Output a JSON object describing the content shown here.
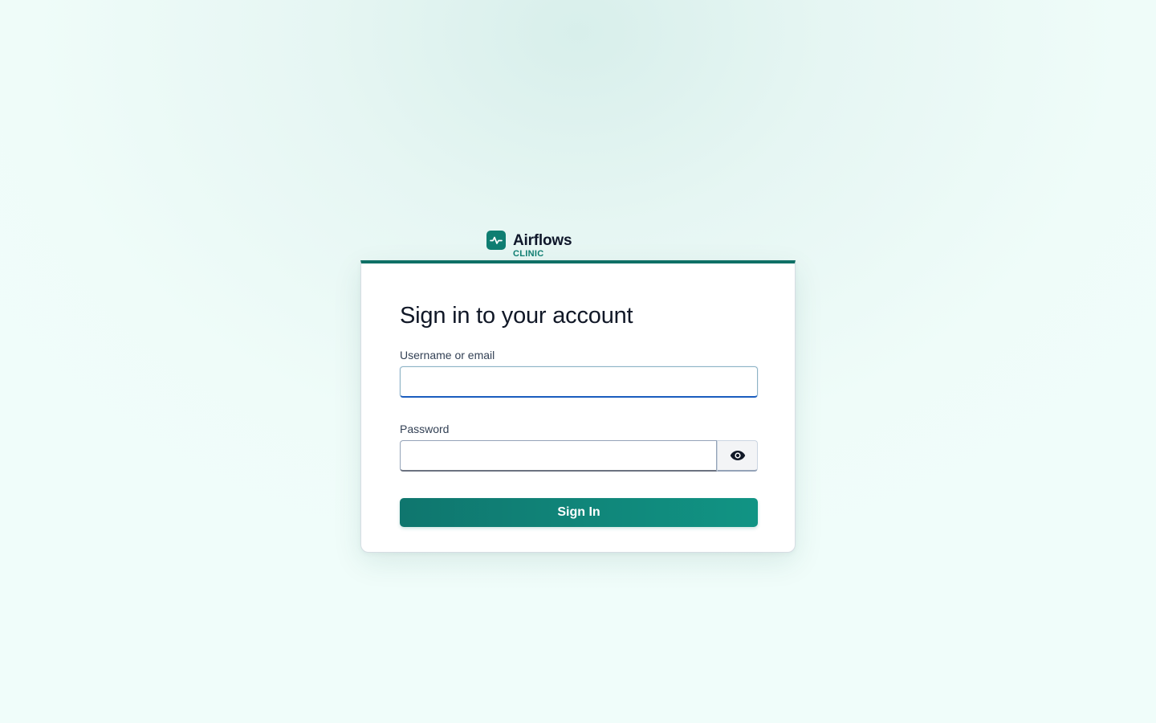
{
  "brand": {
    "name": "Airflows",
    "subtitle": "CLINIC",
    "icon": "activity-pulse-icon"
  },
  "login": {
    "title": "Sign in to your account",
    "username_label": "Username or email",
    "username_value": "",
    "password_label": "Password",
    "password_value": "",
    "show_password_icon": "eye-icon",
    "submit_label": "Sign In"
  },
  "colors": {
    "accent": "#0f766e",
    "accent_light": "#119484",
    "focus_border": "#1d5fbf",
    "background": "#f0fdfa"
  }
}
